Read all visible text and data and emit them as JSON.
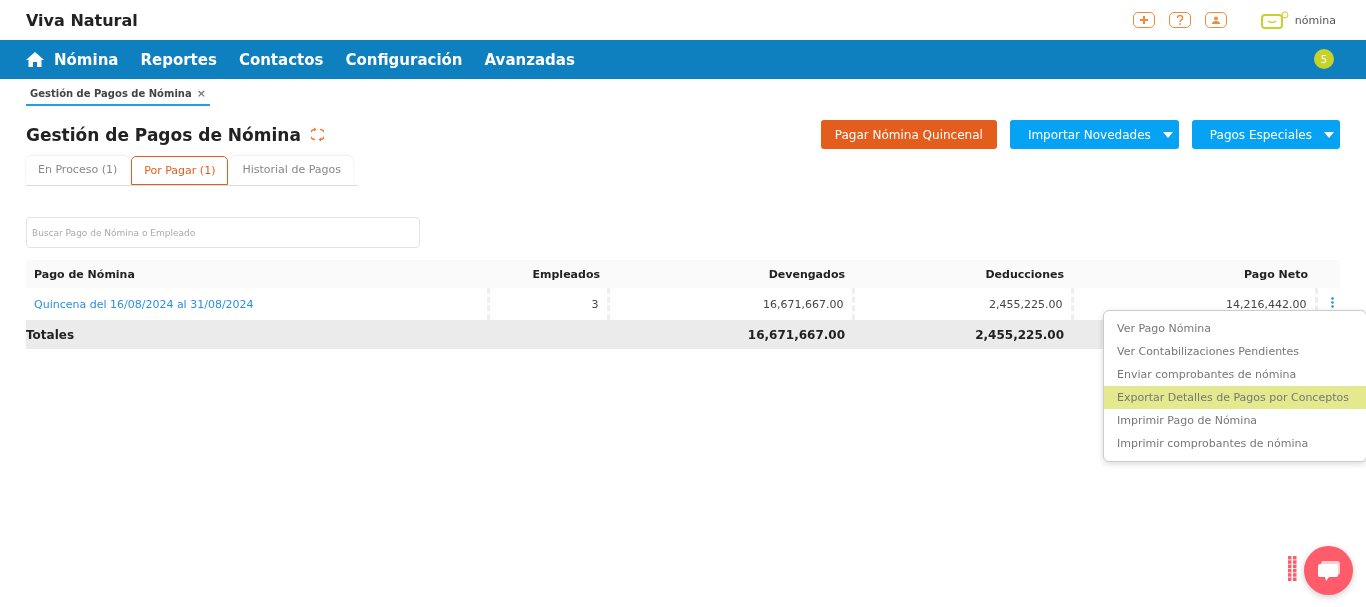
{
  "header": {
    "company": "Viva Natural",
    "brand": "nómina"
  },
  "nav": {
    "items": [
      "Nómina",
      "Reportes",
      "Contactos",
      "Configuración",
      "Avanzadas"
    ],
    "badge": "5"
  },
  "open_tabs": [
    {
      "label": "Gestión de Pagos de Nómina",
      "close": "×",
      "selected": true
    }
  ],
  "page": {
    "title": "Gestión de Pagos de Nómina",
    "actions": [
      {
        "label": "Pagar Nómina Quincenal",
        "kind": "primary"
      },
      {
        "label": "Importar Novedades",
        "kind": "dropdown"
      },
      {
        "label": "Pagos Especiales",
        "kind": "dropdown"
      }
    ]
  },
  "tabs": [
    {
      "label": "En Proceso (1)",
      "selected": false
    },
    {
      "label": "Por Pagar (1)",
      "selected": true
    },
    {
      "label": "Historial de Pagos",
      "selected": false
    }
  ],
  "search": {
    "placeholder": "Buscar Pago de Nómina o Empleado"
  },
  "table": {
    "columns": [
      "Pago de Nómina",
      "Empleados",
      "Devengados",
      "Deducciones",
      "Pago Neto"
    ],
    "rows": [
      {
        "cells": [
          "Quincena del 16/08/2024 al 31/08/2024",
          "3",
          "16,671,667.00",
          "2,455,225.00",
          "14,216,442.00"
        ]
      }
    ],
    "totals": {
      "label": "Totales",
      "devengados": "16,671,667.00",
      "deducciones": "2,455,225.00"
    }
  },
  "menu": [
    {
      "label": "Ver Pago Nómina",
      "selected": false
    },
    {
      "label": "Ver Contabilizaciones Pendientes",
      "selected": false
    },
    {
      "label": "Enviar comprobantes de nómina",
      "selected": false
    },
    {
      "label": "Exportar Detalles de Pagos por Conceptos",
      "selected": true
    },
    {
      "label": "Imprimir Pago de Nómina",
      "selected": false
    },
    {
      "label": "Imprimir comprobantes de nómina",
      "selected": false
    }
  ]
}
